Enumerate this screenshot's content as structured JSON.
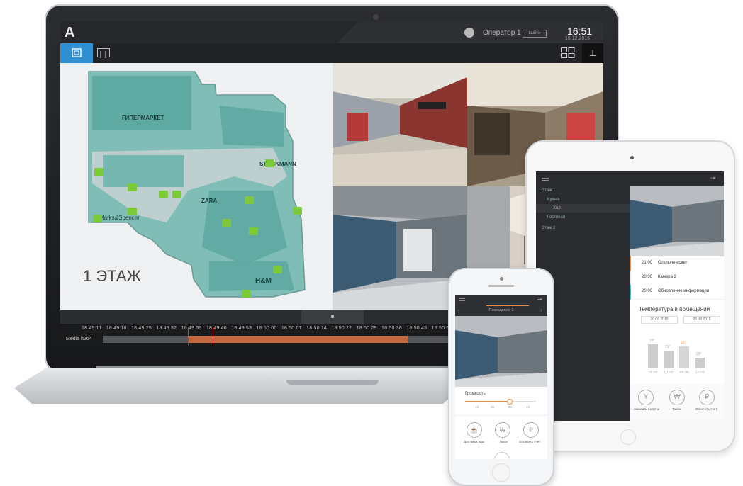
{
  "laptop": {
    "logo": "A",
    "user_name": "Оператор 1",
    "logout_label": "выйти",
    "clock": "16:51",
    "date": "16.12.2015",
    "map": {
      "floor_label": "1 ЭТАЖ",
      "stores": [
        "ГИПЕРМАРКЕТ",
        "STOCKMANN",
        "ZARA",
        "Marks&Spencer",
        "H&M"
      ]
    },
    "pause_icon": "⏸",
    "pin_icon": "⊥",
    "timeline": {
      "ticks": [
        "18:49:11",
        "18:49:18",
        "18:49:25",
        "18:49:32",
        "18:49:39",
        "18:49:46",
        "18:49:53",
        "18:50:00",
        "18:50:07",
        "18:50:14",
        "18:50:22",
        "18:50:29",
        "18:50:36",
        "18:50:43",
        "18:50:50"
      ],
      "track_label": "Media h264"
    }
  },
  "tablet": {
    "nav": [
      "Этаж 1",
      "Кухня",
      "Хол",
      "Гостиная",
      "Этаж 2"
    ],
    "events": [
      {
        "time": "21:00",
        "text": "Отключен свет",
        "color": "#f08c3c"
      },
      {
        "time": "20:30",
        "text": "Камера 2",
        "color": "#e0e0e0"
      },
      {
        "time": "20:00",
        "text": "Обновление информации",
        "color": "#3ec1c9"
      }
    ],
    "temp_title": "Температура в помещении",
    "dates": [
      "26.08.2015",
      "26.08.2015"
    ],
    "bars": [
      {
        "value": "19°",
        "label": "06:00",
        "level": 0.68,
        "highlight": false
      },
      {
        "value": "21°",
        "label": "07:00",
        "level": 0.5,
        "highlight": false
      },
      {
        "value": "22°",
        "label": "09:00",
        "level": 0.62,
        "highlight": true
      },
      {
        "value": "20°",
        "label": "10:00",
        "level": 0.3,
        "highlight": false
      }
    ],
    "actions": [
      {
        "icon": "Y",
        "label": "Заказать напитки"
      },
      {
        "icon": "₩",
        "label": "Такси"
      },
      {
        "icon": "₽",
        "label": "Оплатить счёт"
      }
    ]
  },
  "phone": {
    "title": "Помещение 1",
    "volume_label": "Громкость",
    "volume_ticks": [
      "10",
      "20",
      "30",
      "40"
    ],
    "volume_level": 0.62,
    "actions": [
      {
        "icon": "☕",
        "label": "Доставка еды"
      },
      {
        "icon": "₩",
        "label": "Такси"
      },
      {
        "icon": "₽",
        "label": "Оплатить счёт"
      }
    ]
  },
  "colors": {
    "accent_blue": "#2f8fd0",
    "accent_orange": "#f08c3c",
    "camera_green": "#7cc93a",
    "map_teal": "#5fa9a3"
  }
}
